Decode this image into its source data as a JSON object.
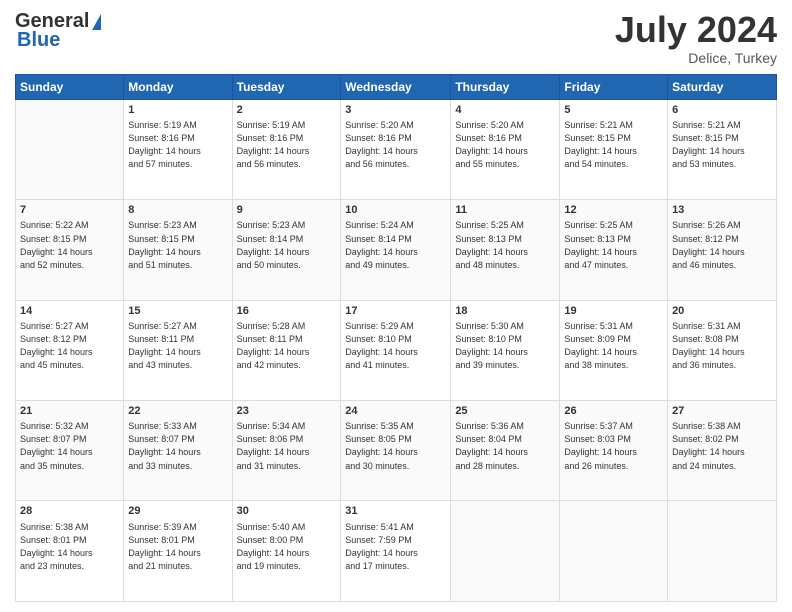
{
  "header": {
    "logo_general": "General",
    "logo_blue": "Blue",
    "title": "July 2024",
    "subtitle": "Delice, Turkey"
  },
  "calendar": {
    "days_of_week": [
      "Sunday",
      "Monday",
      "Tuesday",
      "Wednesday",
      "Thursday",
      "Friday",
      "Saturday"
    ],
    "weeks": [
      [
        {
          "day": "",
          "info": ""
        },
        {
          "day": "1",
          "info": "Sunrise: 5:19 AM\nSunset: 8:16 PM\nDaylight: 14 hours\nand 57 minutes."
        },
        {
          "day": "2",
          "info": "Sunrise: 5:19 AM\nSunset: 8:16 PM\nDaylight: 14 hours\nand 56 minutes."
        },
        {
          "day": "3",
          "info": "Sunrise: 5:20 AM\nSunset: 8:16 PM\nDaylight: 14 hours\nand 56 minutes."
        },
        {
          "day": "4",
          "info": "Sunrise: 5:20 AM\nSunset: 8:16 PM\nDaylight: 14 hours\nand 55 minutes."
        },
        {
          "day": "5",
          "info": "Sunrise: 5:21 AM\nSunset: 8:15 PM\nDaylight: 14 hours\nand 54 minutes."
        },
        {
          "day": "6",
          "info": "Sunrise: 5:21 AM\nSunset: 8:15 PM\nDaylight: 14 hours\nand 53 minutes."
        }
      ],
      [
        {
          "day": "7",
          "info": "Sunrise: 5:22 AM\nSunset: 8:15 PM\nDaylight: 14 hours\nand 52 minutes."
        },
        {
          "day": "8",
          "info": "Sunrise: 5:23 AM\nSunset: 8:15 PM\nDaylight: 14 hours\nand 51 minutes."
        },
        {
          "day": "9",
          "info": "Sunrise: 5:23 AM\nSunset: 8:14 PM\nDaylight: 14 hours\nand 50 minutes."
        },
        {
          "day": "10",
          "info": "Sunrise: 5:24 AM\nSunset: 8:14 PM\nDaylight: 14 hours\nand 49 minutes."
        },
        {
          "day": "11",
          "info": "Sunrise: 5:25 AM\nSunset: 8:13 PM\nDaylight: 14 hours\nand 48 minutes."
        },
        {
          "day": "12",
          "info": "Sunrise: 5:25 AM\nSunset: 8:13 PM\nDaylight: 14 hours\nand 47 minutes."
        },
        {
          "day": "13",
          "info": "Sunrise: 5:26 AM\nSunset: 8:12 PM\nDaylight: 14 hours\nand 46 minutes."
        }
      ],
      [
        {
          "day": "14",
          "info": "Sunrise: 5:27 AM\nSunset: 8:12 PM\nDaylight: 14 hours\nand 45 minutes."
        },
        {
          "day": "15",
          "info": "Sunrise: 5:27 AM\nSunset: 8:11 PM\nDaylight: 14 hours\nand 43 minutes."
        },
        {
          "day": "16",
          "info": "Sunrise: 5:28 AM\nSunset: 8:11 PM\nDaylight: 14 hours\nand 42 minutes."
        },
        {
          "day": "17",
          "info": "Sunrise: 5:29 AM\nSunset: 8:10 PM\nDaylight: 14 hours\nand 41 minutes."
        },
        {
          "day": "18",
          "info": "Sunrise: 5:30 AM\nSunset: 8:10 PM\nDaylight: 14 hours\nand 39 minutes."
        },
        {
          "day": "19",
          "info": "Sunrise: 5:31 AM\nSunset: 8:09 PM\nDaylight: 14 hours\nand 38 minutes."
        },
        {
          "day": "20",
          "info": "Sunrise: 5:31 AM\nSunset: 8:08 PM\nDaylight: 14 hours\nand 36 minutes."
        }
      ],
      [
        {
          "day": "21",
          "info": "Sunrise: 5:32 AM\nSunset: 8:07 PM\nDaylight: 14 hours\nand 35 minutes."
        },
        {
          "day": "22",
          "info": "Sunrise: 5:33 AM\nSunset: 8:07 PM\nDaylight: 14 hours\nand 33 minutes."
        },
        {
          "day": "23",
          "info": "Sunrise: 5:34 AM\nSunset: 8:06 PM\nDaylight: 14 hours\nand 31 minutes."
        },
        {
          "day": "24",
          "info": "Sunrise: 5:35 AM\nSunset: 8:05 PM\nDaylight: 14 hours\nand 30 minutes."
        },
        {
          "day": "25",
          "info": "Sunrise: 5:36 AM\nSunset: 8:04 PM\nDaylight: 14 hours\nand 28 minutes."
        },
        {
          "day": "26",
          "info": "Sunrise: 5:37 AM\nSunset: 8:03 PM\nDaylight: 14 hours\nand 26 minutes."
        },
        {
          "day": "27",
          "info": "Sunrise: 5:38 AM\nSunset: 8:02 PM\nDaylight: 14 hours\nand 24 minutes."
        }
      ],
      [
        {
          "day": "28",
          "info": "Sunrise: 5:38 AM\nSunset: 8:01 PM\nDaylight: 14 hours\nand 23 minutes."
        },
        {
          "day": "29",
          "info": "Sunrise: 5:39 AM\nSunset: 8:01 PM\nDaylight: 14 hours\nand 21 minutes."
        },
        {
          "day": "30",
          "info": "Sunrise: 5:40 AM\nSunset: 8:00 PM\nDaylight: 14 hours\nand 19 minutes."
        },
        {
          "day": "31",
          "info": "Sunrise: 5:41 AM\nSunset: 7:59 PM\nDaylight: 14 hours\nand 17 minutes."
        },
        {
          "day": "",
          "info": ""
        },
        {
          "day": "",
          "info": ""
        },
        {
          "day": "",
          "info": ""
        }
      ]
    ]
  }
}
